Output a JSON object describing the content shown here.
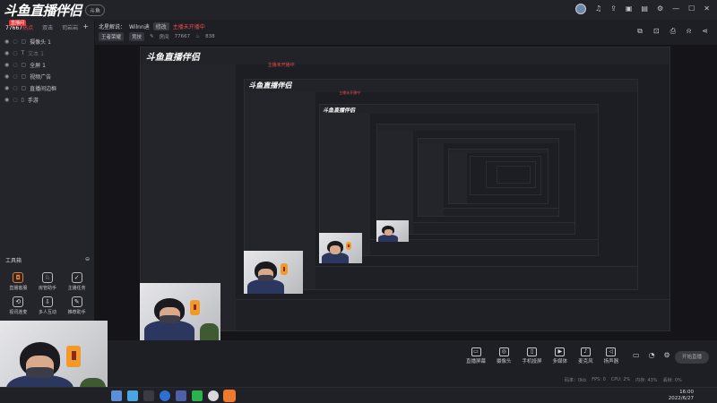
{
  "app": {
    "logo_text": "斗鱼直播伴侣",
    "logo_pill": "斗鱼",
    "colors": {
      "accent": "#f07a2a",
      "danger": "#e74c4c",
      "bg": "#1e1f24"
    }
  },
  "topbar_icons": [
    "avatar",
    "headset-icon",
    "share-icon",
    "feedback-icon",
    "skin-icon",
    "settings-icon",
    "minimize-icon",
    "maximize-icon",
    "close-icon"
  ],
  "left_tabs": [
    {
      "label": "77667",
      "badge": "直播间",
      "active": true,
      "suffix": "热点"
    },
    {
      "label": "双击"
    },
    {
      "label": "司岩岩"
    }
  ],
  "sources": [
    {
      "label": "摄像头 1",
      "dim": false
    },
    {
      "label": "文本 1",
      "dim": true
    },
    {
      "label": "全屏 1",
      "dim": false
    },
    {
      "label": "视频广告",
      "dim": false
    },
    {
      "label": "直播间边框",
      "dim": false
    },
    {
      "label": "手游",
      "dim": false
    }
  ],
  "toolbox": {
    "title": "工具箱",
    "tools": [
      {
        "label": "直播客服",
        "orange": true
      },
      {
        "label": "房管助手",
        "orange": false
      },
      {
        "label": "主播任务",
        "orange": false
      },
      {
        "label": "视讯连麦",
        "orange": false
      },
      {
        "label": "多人互动",
        "orange": false
      },
      {
        "label": "推荐助手",
        "orange": false
      }
    ]
  },
  "header": {
    "title_prefix": "北星解说：",
    "title_name": "Wilnn迪",
    "tag": "修改",
    "status": "主播未开播中",
    "category": "王者荣耀",
    "mode": "竞技",
    "id_label": "房间",
    "id_value": "77667",
    "fans": "838"
  },
  "controls": [
    {
      "label": "直播屏幕"
    },
    {
      "label": "摄像头"
    },
    {
      "label": "手机投屏"
    },
    {
      "label": "多媒体"
    },
    {
      "label": "麦克风"
    },
    {
      "label": "扬声器"
    }
  ],
  "live_button": "开始直播",
  "status_line": [
    "码率：0kb",
    "FPS: 0",
    "CPU: 2%",
    "内存: 43%",
    "丢帧: 0%"
  ],
  "taskbar": {
    "time": "16:00",
    "date": "2022/6/27"
  }
}
